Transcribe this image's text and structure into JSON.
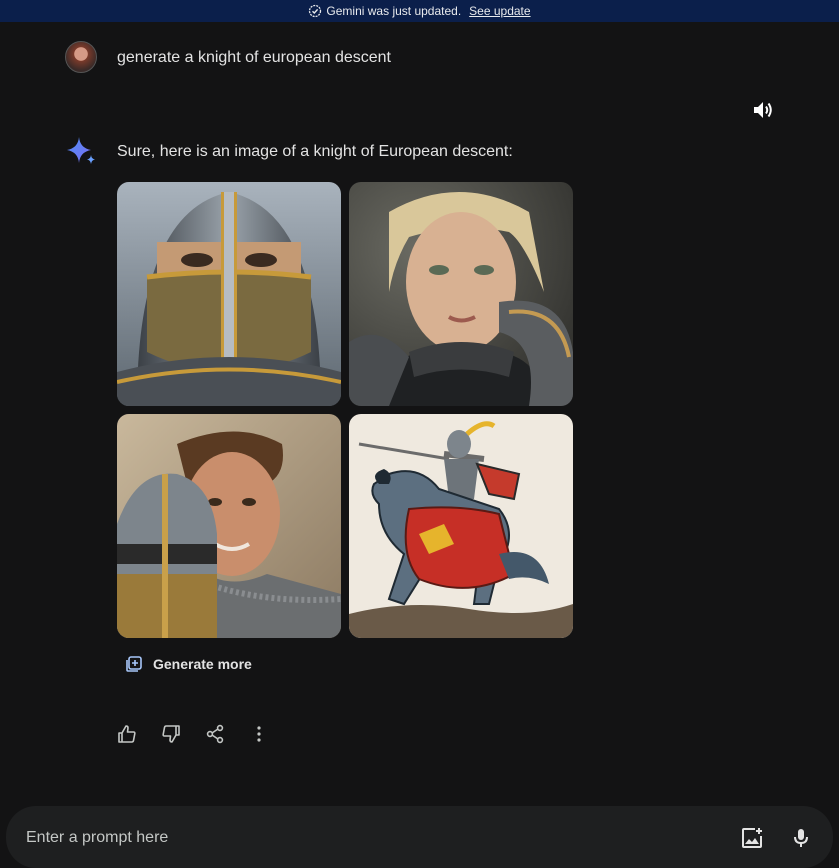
{
  "banner": {
    "message": "Gemini was just updated.",
    "link_label": "See update"
  },
  "conversation": {
    "user_prompt": "generate a knight of european descent",
    "response_text": "Sure, here is an image of a knight of European descent:",
    "images": [
      {
        "name": "helmeted-knight-face"
      },
      {
        "name": "blonde-woman-in-armor"
      },
      {
        "name": "smiling-man-with-helmet"
      },
      {
        "name": "mounted-knight-illustration"
      }
    ],
    "generate_more_label": "Generate more"
  },
  "prompt": {
    "placeholder": "Enter a prompt here"
  },
  "colors": {
    "background": "#131314",
    "banner": "#0b1f4b",
    "prompt_bar": "#1e1f20",
    "text": "#e3e3e3"
  },
  "icons": [
    "check-circle-icon",
    "speaker-icon",
    "gemini-sparkle-icon",
    "generate-more-icon",
    "thumbs-up-icon",
    "thumbs-down-icon",
    "share-icon",
    "more-vert-icon",
    "image-upload-icon",
    "microphone-icon"
  ]
}
